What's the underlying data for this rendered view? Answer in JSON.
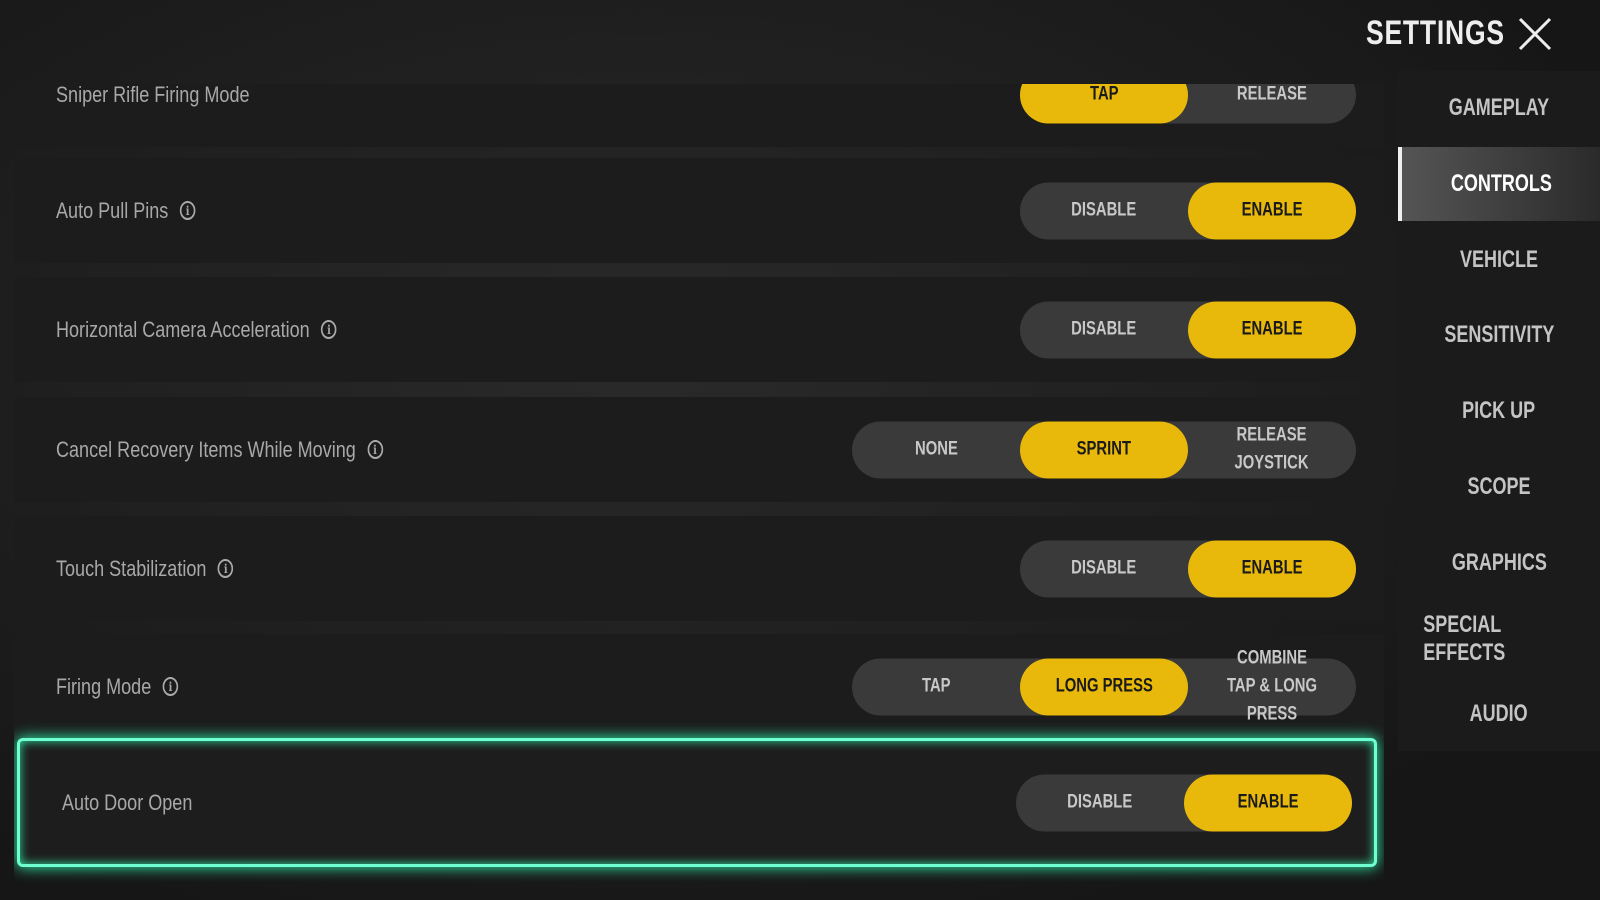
{
  "header": {
    "title": "SETTINGS",
    "close_icon": "close-icon"
  },
  "accent_color": "#e8b90a",
  "highlight_color": "#2fe0a0",
  "settings": [
    {
      "label": "Sniper Rifle Firing Mode",
      "info": false,
      "options": [
        "TAP",
        "RELEASE"
      ],
      "selected": 0
    },
    {
      "label": "Auto Pull Pins",
      "info": true,
      "options": [
        "DISABLE",
        "ENABLE"
      ],
      "selected": 1
    },
    {
      "label": "Horizontal Camera Acceleration",
      "info": true,
      "options": [
        "DISABLE",
        "ENABLE"
      ],
      "selected": 1
    },
    {
      "label": "Cancel Recovery Items While Moving",
      "info": true,
      "options": [
        "NONE",
        "SPRINT",
        "RELEASE\nJOYSTICK"
      ],
      "selected": 1
    },
    {
      "label": "Touch Stabilization",
      "info": true,
      "options": [
        "DISABLE",
        "ENABLE"
      ],
      "selected": 1
    },
    {
      "label": "Firing Mode",
      "info": true,
      "options": [
        "TAP",
        "LONG PRESS",
        "COMBINE\nTAP & LONG PRESS"
      ],
      "selected": 1
    },
    {
      "label": "Auto Door Open",
      "info": false,
      "options": [
        "DISABLE",
        "ENABLE"
      ],
      "selected": 1,
      "highlighted": true
    }
  ],
  "sidebar": {
    "items": [
      "GAMEPLAY",
      "CONTROLS",
      "VEHICLE",
      "SENSITIVITY",
      "PICK UP",
      "SCOPE",
      "GRAPHICS",
      "SPECIAL EFFECTS",
      "AUDIO"
    ],
    "active": 1
  }
}
